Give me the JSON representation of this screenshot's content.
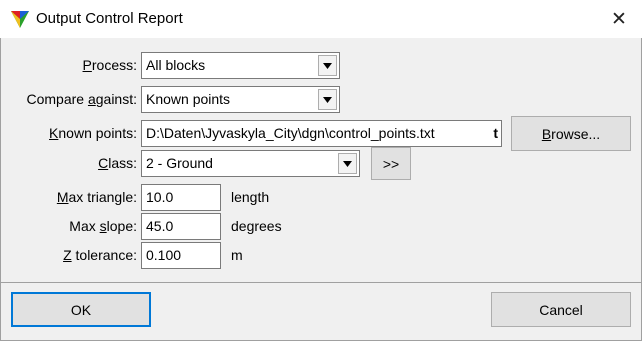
{
  "window": {
    "title": "Output Control Report",
    "close_glyph": "✕"
  },
  "form": {
    "process": {
      "label_pre": "",
      "label_u": "P",
      "label_post": "rocess:",
      "value": "All blocks"
    },
    "compare": {
      "label_pre": "Compare ",
      "label_u": "a",
      "label_post": "gainst:",
      "value": "Known points"
    },
    "known_points": {
      "label_pre": "",
      "label_u": "K",
      "label_post": "nown points:",
      "value": "D:\\Daten\\Jyvaskyla_City\\dgn\\control_points.txt",
      "overflow_glyph": "t"
    },
    "browse_button": {
      "label_pre": "",
      "label_u": "B",
      "label_post": "rowse..."
    },
    "class": {
      "label_pre": "",
      "label_u": "C",
      "label_post": "lass:",
      "value": "2 - Ground"
    },
    "class_button": {
      "label": ">>"
    },
    "max_triangle": {
      "label_pre": "",
      "label_u": "M",
      "label_post": "ax triangle:",
      "value": "10.0",
      "unit": "length"
    },
    "max_slope": {
      "label_pre": "Max ",
      "label_u": "s",
      "label_post": "lope:",
      "value": "45.0",
      "unit": "degrees"
    },
    "z_tolerance": {
      "label_pre": "",
      "label_u": "Z",
      "label_post": " tolerance:",
      "value": "0.100",
      "unit": "m"
    }
  },
  "footer": {
    "ok_label": "OK",
    "cancel_label": "Cancel"
  },
  "icons": {
    "app": "terrasolid-triangle-icon",
    "dropdown": "chevron-down-icon"
  }
}
